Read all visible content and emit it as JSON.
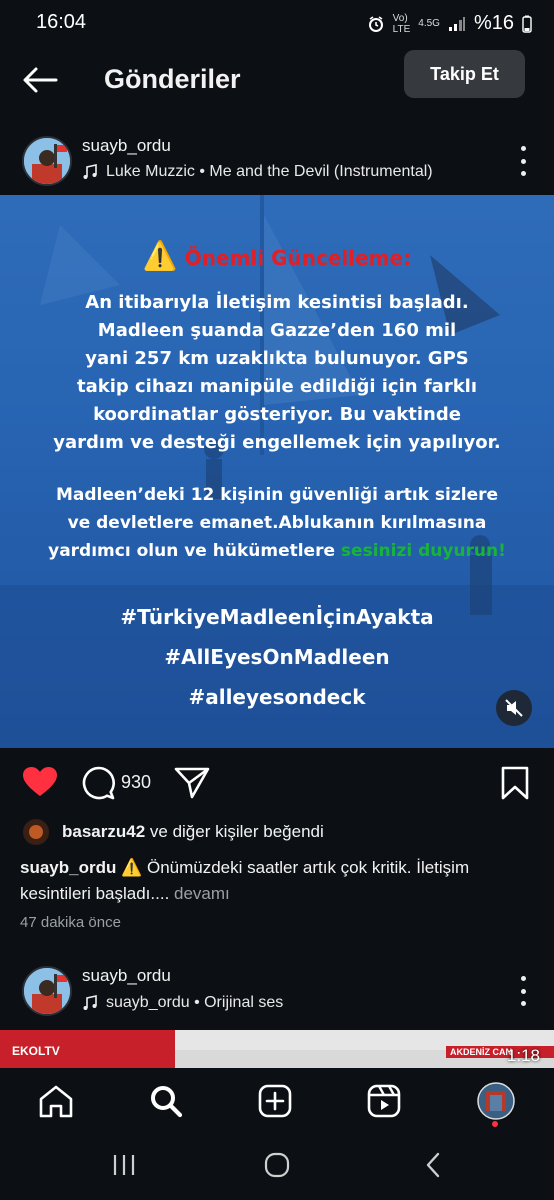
{
  "status": {
    "time": "16:04",
    "network_top": "Vo)",
    "network_bottom": "LTE",
    "network_gen": "4.5G",
    "battery": "%16"
  },
  "header": {
    "title": "Gönderiler",
    "follow_label": "Takip Et"
  },
  "post1": {
    "username": "suayb_ordu",
    "music": "Luke Muzzic • Me and the Devil (Instrumental)",
    "image_heading": "Önemli Güncelleme:",
    "image_lines": [
      "An itibarıyla İletişim kesintisi başladı.",
      "Madleen şuanda Gazze’den 160 mil",
      "yani 257 km uzaklıkta bulunuyor. GPS",
      "takip cihazı manipüle edildiği için farklı",
      "koordinatlar gösteriyor. Bu vaktinde",
      "yardım ve desteği engellemek için yapılıyor."
    ],
    "image_lines2": [
      "Madleen’deki 12 kişinin güvenliği artık sizlere",
      "ve devletlere emanet.Ablukanın kırılmasına"
    ],
    "image_line_last_a": "yardımcı olun ve hükümetlere ",
    "image_line_last_b": "sesinizi duyurun!",
    "hashtags": [
      "#TürkiyeMadleenİçinAyakta",
      "#AllEyesOnMadleen",
      "#alleyesondeck"
    ],
    "comment_count": "930",
    "likers_user": "basarzu42",
    "likers_rest": " ve diğer kişiler beğendi",
    "caption_user": "suayb_ordu",
    "caption_text": " ⚠️ Önümüzdeki saatler artık çok kritik. İletişim kesintileri başladı....",
    "caption_more": " devamı",
    "time_ago": "47 dakika önce"
  },
  "post2": {
    "username": "suayb_ordu",
    "music": "suayb_ordu • Orijinal ses",
    "logo": "EKOLTV",
    "banner": "AKDENİZ CAN",
    "duration": "1:18"
  },
  "colors": {
    "background": "#0c1014",
    "like": "#ff3040",
    "media_blue": "#2f6fbd"
  }
}
